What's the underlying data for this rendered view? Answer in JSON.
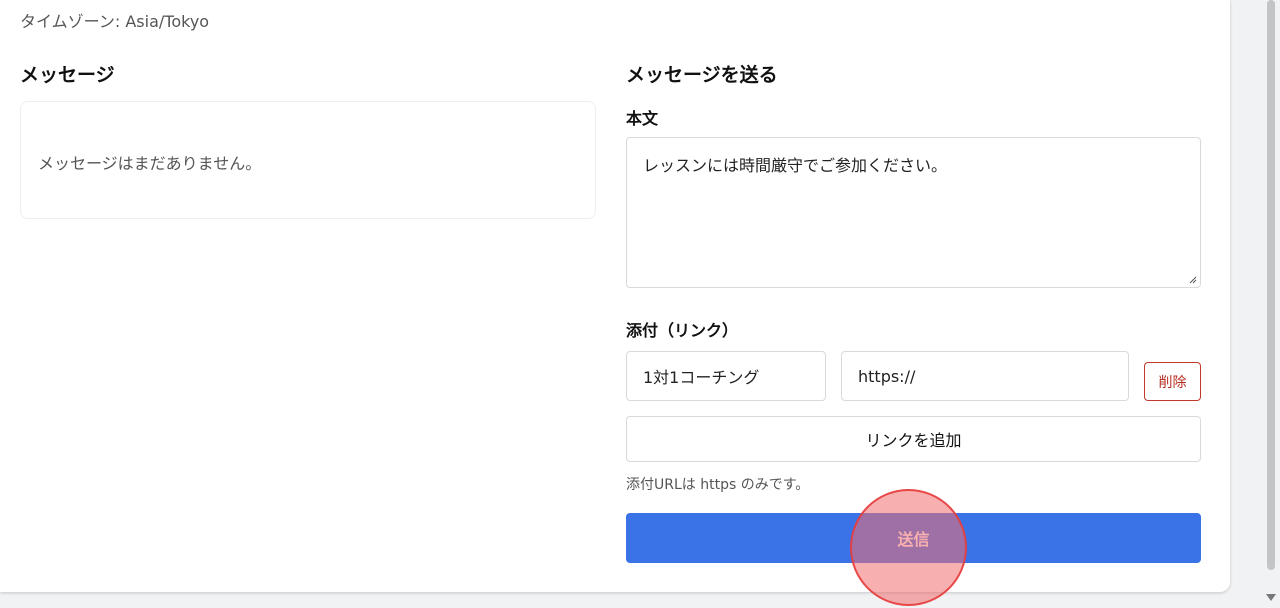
{
  "header": {
    "timezone": "タイムゾーン: Asia/Tokyo"
  },
  "messages": {
    "title": "メッセージ",
    "empty_text": "メッセージはまだありません。"
  },
  "compose": {
    "title": "メッセージを送る",
    "body_label": "本文",
    "body_value": "レッスンには時間厳守でご参加ください。",
    "attachments_label": "添付（リンク）",
    "attachment": {
      "name_value": "1対1コーチング",
      "url_value": "https://"
    },
    "delete_label": "削除",
    "add_link_label": "リンクを追加",
    "hint": "添付URLは https のみです。",
    "send_label": "送信"
  },
  "colors": {
    "primary": "#3a73e8",
    "danger": "#c0392b"
  }
}
